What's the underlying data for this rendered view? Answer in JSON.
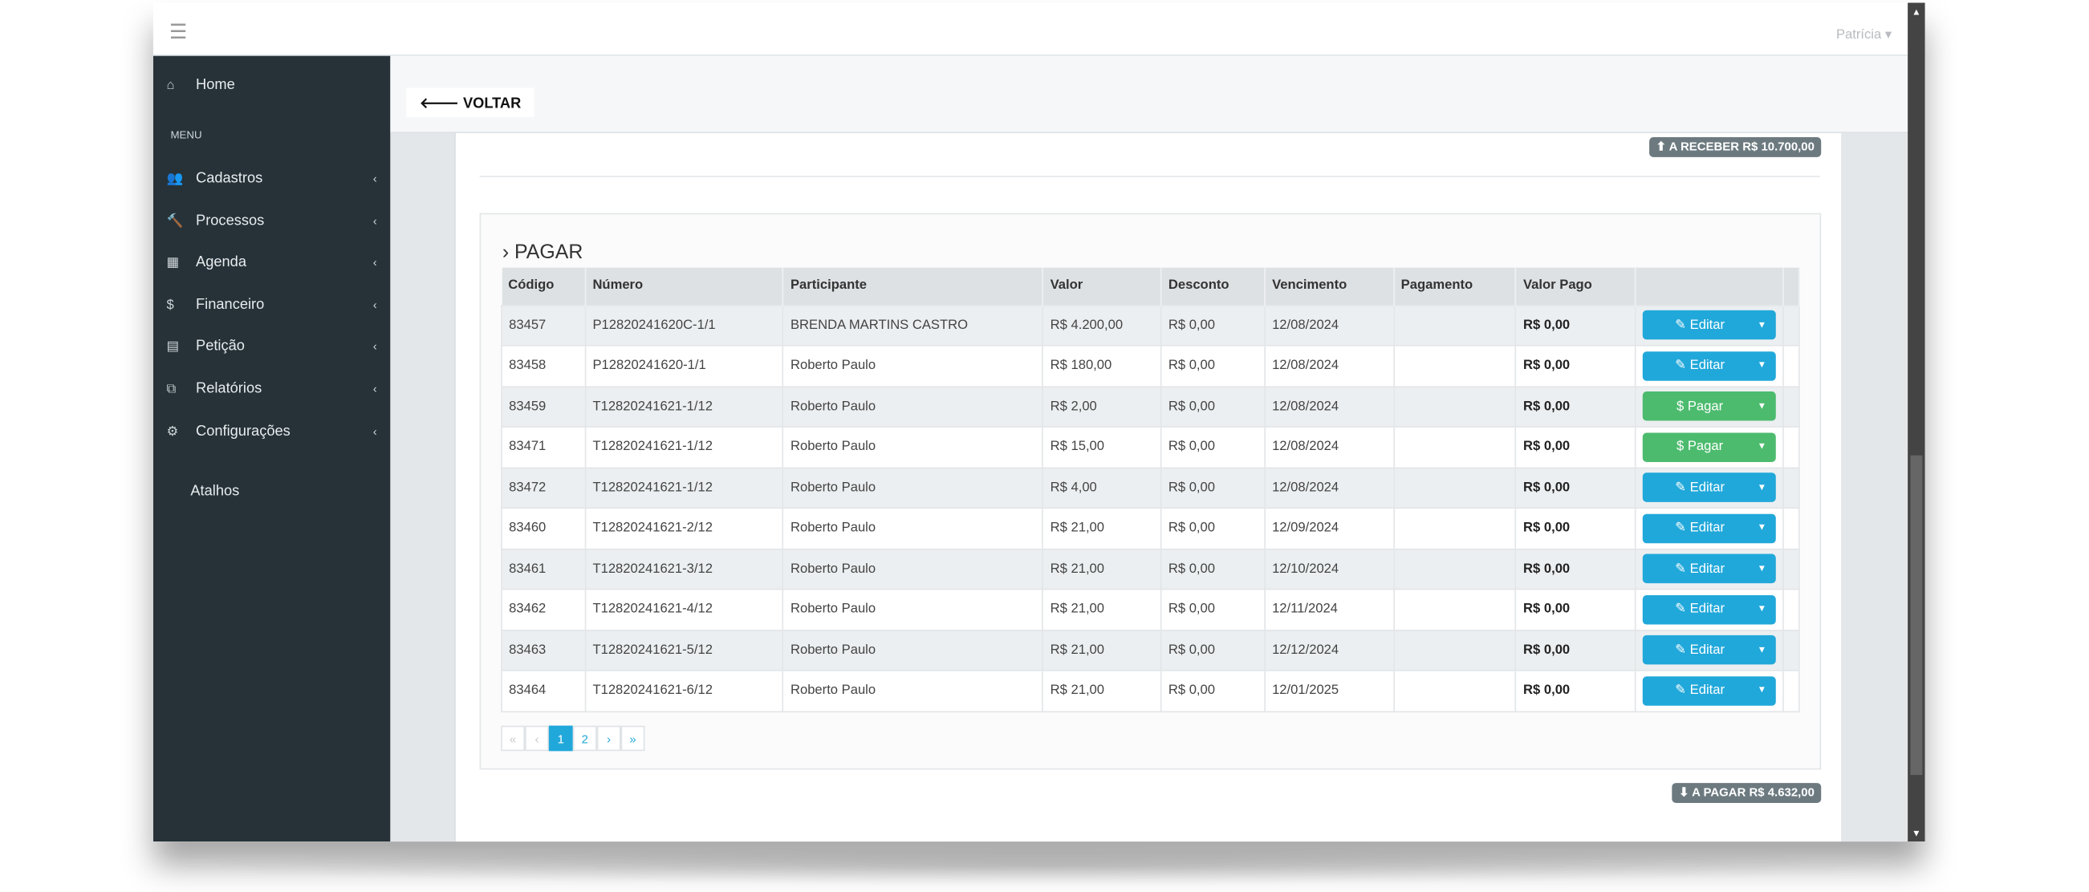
{
  "topbar": {
    "menu_icon": "hamburger-icon",
    "user": "Patrícia"
  },
  "sidebar": {
    "home": "Home",
    "menu_heading": "MENU",
    "items": [
      {
        "label": "Cadastros",
        "icon": "users-icon"
      },
      {
        "label": "Processos",
        "icon": "gavel-icon"
      },
      {
        "label": "Agenda",
        "icon": "calendar-icon"
      },
      {
        "label": "Financeiro",
        "icon": "dollar-icon"
      },
      {
        "label": "Petição",
        "icon": "document-icon"
      },
      {
        "label": "Relatórios",
        "icon": "copy-icon"
      },
      {
        "label": "Configurações",
        "icon": "gear-icon"
      }
    ],
    "atalhos": "Atalhos"
  },
  "toolbar": {
    "back_label": "VOLTAR"
  },
  "badges": {
    "receber": "A RECEBER R$ 10.700,00",
    "pagar": "A PAGAR R$ 4.632,00"
  },
  "section": {
    "title": "PAGAR"
  },
  "table": {
    "headers": [
      "Código",
      "Número",
      "Participante",
      "Valor",
      "Desconto",
      "Vencimento",
      "Pagamento",
      "Valor Pago"
    ],
    "rows": [
      {
        "codigo": "83457",
        "numero": "P12820241620C-1/1",
        "participante": "BRENDA MARTINS CASTRO",
        "valor": "R$ 4.200,00",
        "desconto": "R$ 0,00",
        "vencimento": "12/08/2024",
        "pagamento": "",
        "valor_pago": "R$ 0,00",
        "action": "Editar"
      },
      {
        "codigo": "83458",
        "numero": "P12820241620-1/1",
        "participante": "Roberto Paulo",
        "valor": "R$ 180,00",
        "desconto": "R$ 0,00",
        "vencimento": "12/08/2024",
        "pagamento": "",
        "valor_pago": "R$ 0,00",
        "action": "Editar"
      },
      {
        "codigo": "83459",
        "numero": "T12820241621-1/12",
        "participante": "Roberto Paulo",
        "valor": "R$ 2,00",
        "desconto": "R$ 0,00",
        "vencimento": "12/08/2024",
        "pagamento": "",
        "valor_pago": "R$ 0,00",
        "action": "Pagar"
      },
      {
        "codigo": "83471",
        "numero": "T12820241621-1/12",
        "participante": "Roberto Paulo",
        "valor": "R$ 15,00",
        "desconto": "R$ 0,00",
        "vencimento": "12/08/2024",
        "pagamento": "",
        "valor_pago": "R$ 0,00",
        "action": "Pagar"
      },
      {
        "codigo": "83472",
        "numero": "T12820241621-1/12",
        "participante": "Roberto Paulo",
        "valor": "R$ 4,00",
        "desconto": "R$ 0,00",
        "vencimento": "12/08/2024",
        "pagamento": "",
        "valor_pago": "R$ 0,00",
        "action": "Editar"
      },
      {
        "codigo": "83460",
        "numero": "T12820241621-2/12",
        "participante": "Roberto Paulo",
        "valor": "R$ 21,00",
        "desconto": "R$ 0,00",
        "vencimento": "12/09/2024",
        "pagamento": "",
        "valor_pago": "R$ 0,00",
        "action": "Editar"
      },
      {
        "codigo": "83461",
        "numero": "T12820241621-3/12",
        "participante": "Roberto Paulo",
        "valor": "R$ 21,00",
        "desconto": "R$ 0,00",
        "vencimento": "12/10/2024",
        "pagamento": "",
        "valor_pago": "R$ 0,00",
        "action": "Editar"
      },
      {
        "codigo": "83462",
        "numero": "T12820241621-4/12",
        "participante": "Roberto Paulo",
        "valor": "R$ 21,00",
        "desconto": "R$ 0,00",
        "vencimento": "12/11/2024",
        "pagamento": "",
        "valor_pago": "R$ 0,00",
        "action": "Editar"
      },
      {
        "codigo": "83463",
        "numero": "T12820241621-5/12",
        "participante": "Roberto Paulo",
        "valor": "R$ 21,00",
        "desconto": "R$ 0,00",
        "vencimento": "12/12/2024",
        "pagamento": "",
        "valor_pago": "R$ 0,00",
        "action": "Editar"
      },
      {
        "codigo": "83464",
        "numero": "T12820241621-6/12",
        "participante": "Roberto Paulo",
        "valor": "R$ 21,00",
        "desconto": "R$ 0,00",
        "vencimento": "12/01/2025",
        "pagamento": "",
        "valor_pago": "R$ 0,00",
        "action": "Editar"
      }
    ]
  },
  "pagination": {
    "first": "«",
    "prev": "‹",
    "pages": [
      "1",
      "2"
    ],
    "current": "1",
    "next": "›",
    "last": "»"
  },
  "colors": {
    "sidebar": "#263238",
    "edit": "#21a8da",
    "pay": "#4cbb6e",
    "badge": "#6c7a80"
  }
}
